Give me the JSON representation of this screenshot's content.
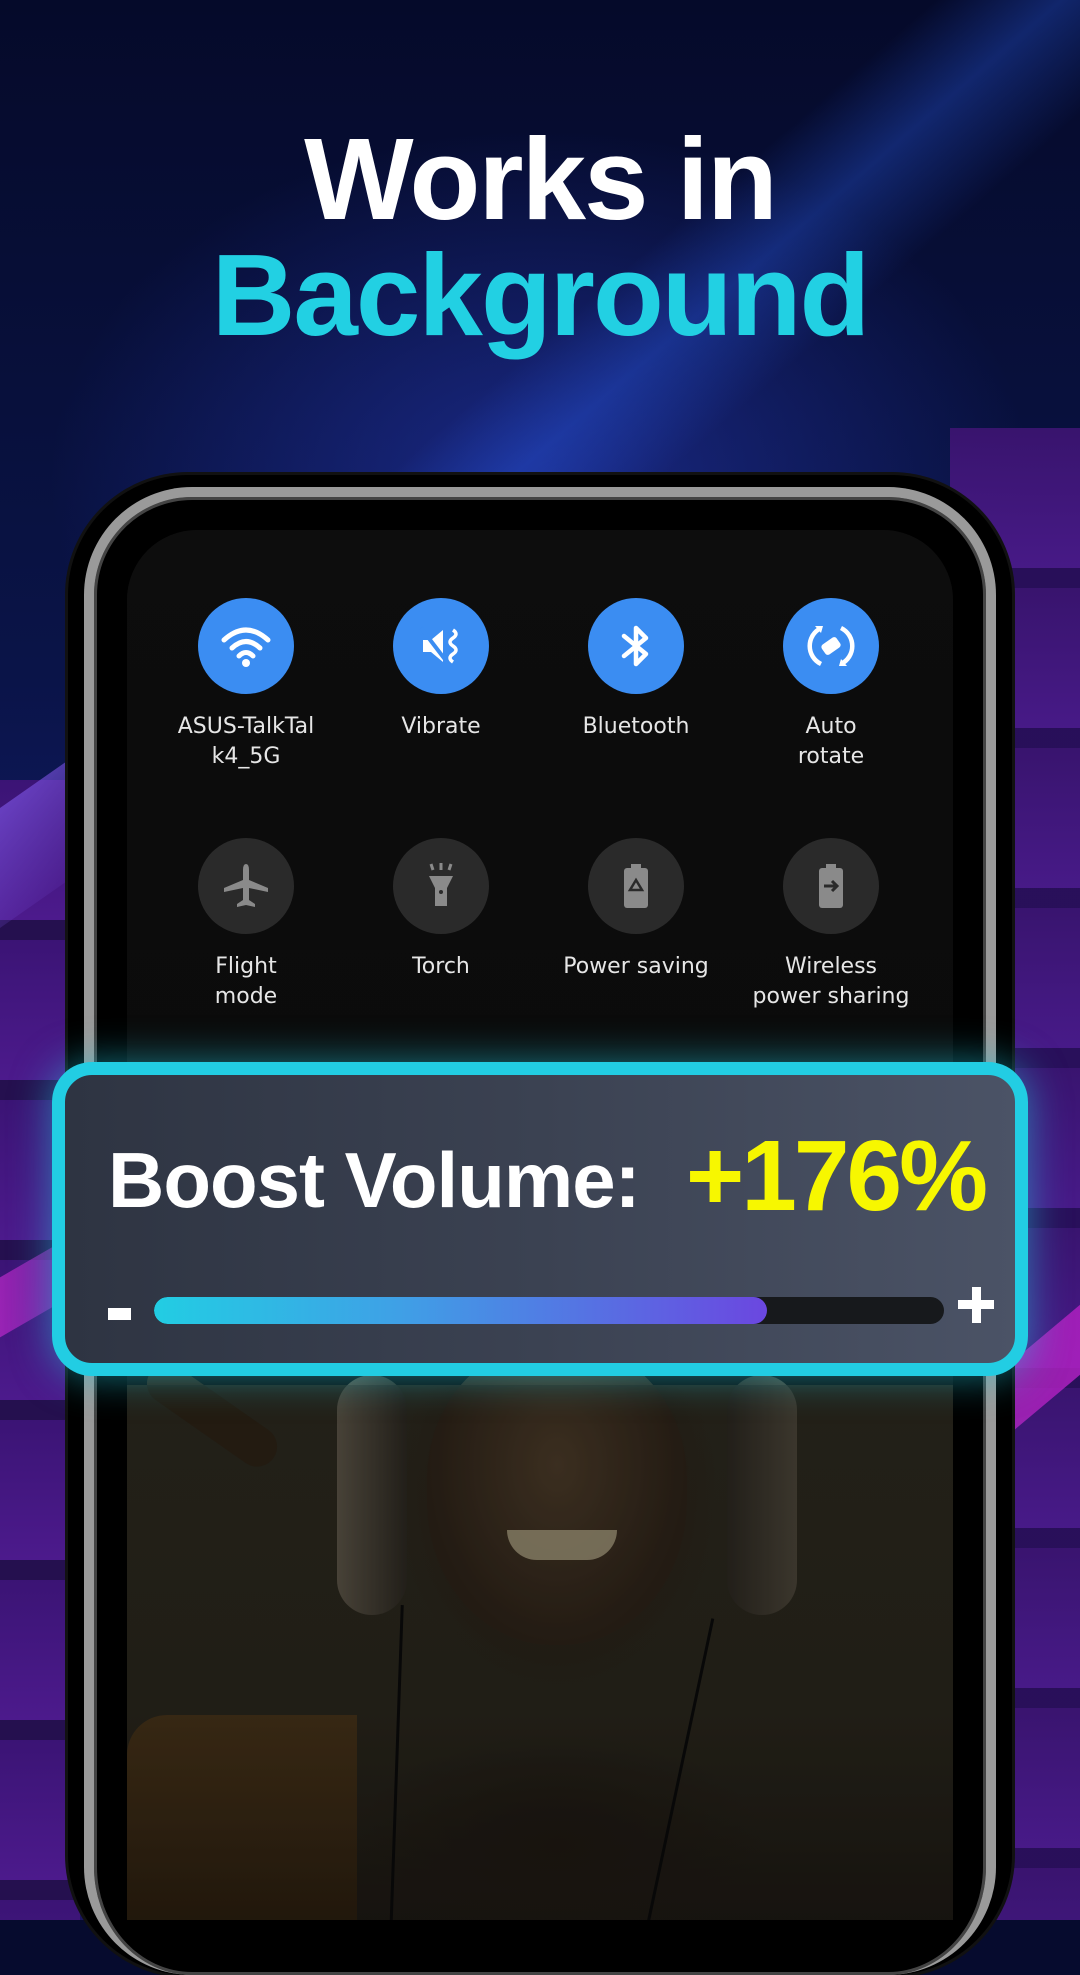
{
  "headline": {
    "line1": "Works in",
    "line2": "Background"
  },
  "colors": {
    "accent_cyan": "#22cde3",
    "value_yellow": "#f7f700",
    "tile_active": "#3b8df2",
    "tile_inactive": "#2a2a2a"
  },
  "quick_settings": {
    "tiles": [
      {
        "label": "ASUS-TalkTal\nk4_5G",
        "icon": "wifi-icon",
        "active": true
      },
      {
        "label": "Vibrate",
        "icon": "vibrate-icon",
        "active": true
      },
      {
        "label": "Bluetooth",
        "icon": "bluetooth-icon",
        "active": true
      },
      {
        "label": "Auto\nrotate",
        "icon": "auto-rotate-icon",
        "active": true
      },
      {
        "label": "Flight\nmode",
        "icon": "airplane-icon",
        "active": false
      },
      {
        "label": "Torch",
        "icon": "flashlight-icon",
        "active": false
      },
      {
        "label": "Power saving",
        "icon": "battery-saver-icon",
        "active": false
      },
      {
        "label": "Wireless\npower sharing",
        "icon": "battery-share-icon",
        "active": false
      }
    ]
  },
  "volume_card": {
    "title": "Boost Volume:",
    "value": "+176%",
    "decrease_label": "-",
    "increase_label": "+",
    "slider_fraction": 0.776
  }
}
